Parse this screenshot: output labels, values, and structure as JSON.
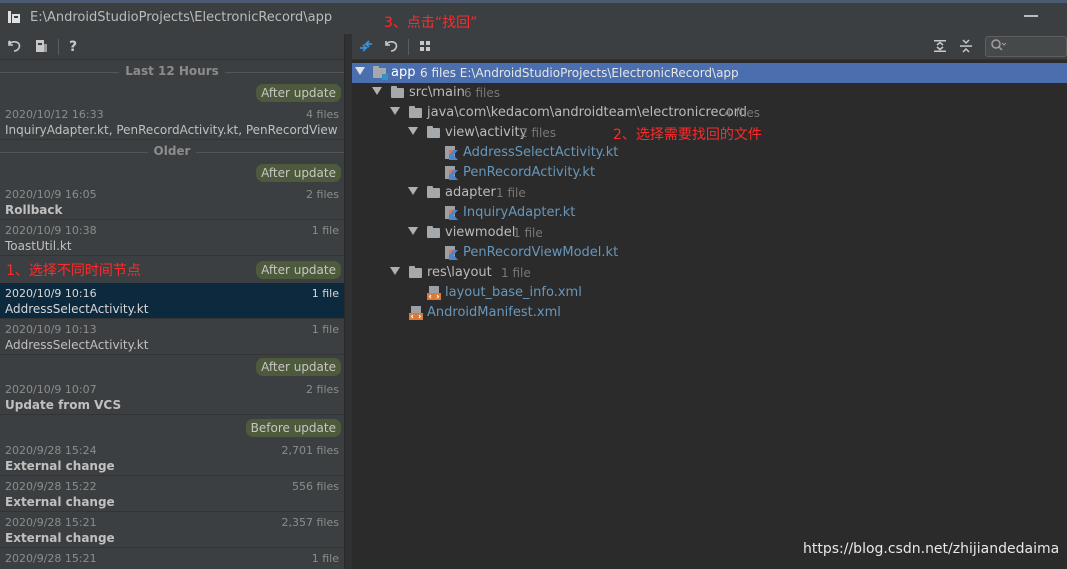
{
  "window": {
    "path": "E:\\AndroidStudioProjects\\ElectronicRecord\\app"
  },
  "annotations": {
    "step1": "1、选择不同时间节点",
    "step2": "2、选择需要找回的文件",
    "step3": "3、点击“找回”"
  },
  "left_toolbar": {
    "buttons": [
      {
        "icon": "undo-icon"
      },
      {
        "icon": "put-label-icon"
      },
      {
        "icon": "help-icon",
        "label": "?"
      }
    ]
  },
  "right_toolbar": {
    "buttons": [
      {
        "icon": "diff-icon"
      },
      {
        "icon": "revert-icon"
      },
      {
        "icon": "group-by-icon"
      },
      {
        "icon": "expand-all-icon"
      },
      {
        "icon": "collapse-all-icon"
      }
    ],
    "search": {
      "icon": "search-icon",
      "value": ""
    }
  },
  "history": {
    "groups": {
      "recent": "Last 12 Hours",
      "older": "Older"
    },
    "badges": {
      "b1": "After update",
      "b2": "After update",
      "b3": "After update",
      "b4": "After update",
      "b5": "Before update"
    },
    "entries": [
      {
        "date": "2020/10/12 16:33",
        "count": "4 files",
        "desc": "InquiryAdapter.kt, PenRecordActivity.kt, PenRecordView…"
      },
      {
        "date": "2020/10/9 16:05",
        "count": "2 files",
        "desc": "Rollback"
      },
      {
        "date": "2020/10/9 10:38",
        "count": "1 file",
        "desc": "ToastUtil.kt"
      },
      {
        "date": "2020/10/9 10:16",
        "count": "1 file",
        "desc": "AddressSelectActivity.kt"
      },
      {
        "date": "2020/10/9 10:13",
        "count": "1 file",
        "desc": "AddressSelectActivity.kt"
      },
      {
        "date": "2020/10/9 10:07",
        "count": "2 files",
        "desc": "Update from VCS"
      },
      {
        "date": "2020/9/28 15:24",
        "count": "2,701 files",
        "desc": "External change"
      },
      {
        "date": "2020/9/28 15:22",
        "count": "556 files",
        "desc": "External change"
      },
      {
        "date": "2020/9/28 15:21",
        "count": "2,357 files",
        "desc": "External change"
      },
      {
        "date": "2020/9/28 15:21",
        "count": "1 file",
        "desc": ""
      }
    ]
  },
  "tree": {
    "rows": [
      {
        "name": "app",
        "meta": "6 files  E:\\AndroidStudioProjects\\ElectronicRecord\\app"
      },
      {
        "name": "src\\main",
        "meta": "6 files"
      },
      {
        "name": "java\\com\\kedacom\\androidteam\\electronicrecord",
        "meta": "4 files"
      },
      {
        "name": "view\\activity",
        "meta": "2 files"
      },
      {
        "name": "AddressSelectActivity.kt"
      },
      {
        "name": "PenRecordActivity.kt"
      },
      {
        "name": "adapter",
        "meta": "1 file"
      },
      {
        "name": "InquiryAdapter.kt"
      },
      {
        "name": "viewmodel",
        "meta": "1 file"
      },
      {
        "name": "PenRecordViewModel.kt"
      },
      {
        "name": "res\\layout",
        "meta": "1 file"
      },
      {
        "name": "layout_base_info.xml"
      },
      {
        "name": "AndroidManifest.xml"
      }
    ]
  },
  "watermark": "https://blog.csdn.net/zhijiandedaima"
}
